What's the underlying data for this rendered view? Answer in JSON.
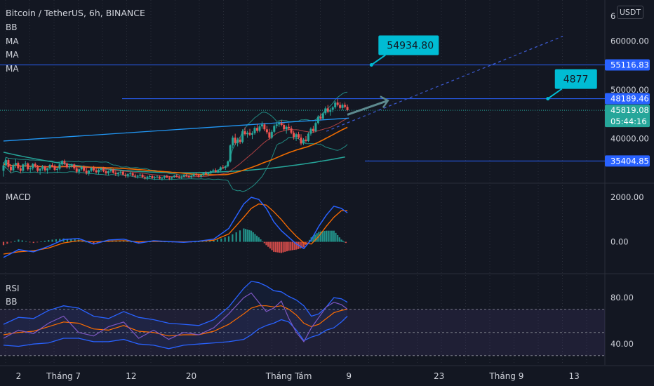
{
  "header": {
    "title": "Bitcoin / TetherUS, 6h, BINANCE",
    "unit": "USDT",
    "indicators": [
      "BB",
      "MA",
      "MA",
      "MA"
    ]
  },
  "colors": {
    "up": "#26a69a",
    "down": "#ef5350",
    "hline": "#2962ff",
    "callout": "#00bcd4",
    "projection": "#3a57c9",
    "arrow": "#5d8a8f",
    "ma_short": "#ef6c00",
    "ma_long": "#26a69a",
    "bb": "#2962ff",
    "trend": "#2196f3",
    "macd": "#2962ff",
    "signal": "#ff6d00",
    "rsi": "#7e57c2",
    "rsi_ma": "#ff6d00"
  },
  "chart_data": [
    {
      "type": "candlestick",
      "ylim": [
        31000,
        68000
      ],
      "y_ticks": [
        40000,
        50000,
        60000
      ],
      "y_tick_labels": [
        "40000.00",
        "50000.00",
        "60000.00"
      ],
      "partial_top_label": "6",
      "x_labels": [
        "2",
        "Tháng 7",
        "12",
        "20",
        "Tháng Tám",
        "9",
        "23",
        "Tháng 9",
        "13"
      ],
      "x_label_days": [
        2,
        8,
        17,
        25,
        38,
        46,
        58,
        67,
        76
      ],
      "candle_days": [
        0,
        45.8
      ],
      "levels": [
        {
          "name": "resistance",
          "price": 55116.83,
          "label": "55116.83"
        },
        {
          "name": "target",
          "price": 48189.46,
          "label": "48189.46"
        },
        {
          "name": "support",
          "price": 35404.85,
          "label": "35404.85"
        }
      ],
      "last_price": {
        "price": 45819.08,
        "label": "45819.08",
        "countdown": "05:44:16"
      },
      "callouts": [
        {
          "text": "54934.80",
          "day": 49,
          "price": 55116.83
        },
        {
          "text": "4877",
          "day": 72.5,
          "price": 48189.46
        }
      ],
      "projection_line": {
        "from": [
          43,
          41500
        ],
        "to": [
          74.5,
          61000
        ]
      },
      "arrow": {
        "from": [
          45.8,
          44900
        ],
        "to": [
          51.2,
          47800
        ]
      },
      "trend_line": {
        "from": [
          0,
          39500
        ],
        "to": [
          46,
          44200
        ]
      },
      "ohlc": [
        [
          33.4,
          35.2,
          32.2,
          34.5
        ],
        [
          34.5,
          36.2,
          34.0,
          35.6
        ],
        [
          35.6,
          35.9,
          33.8,
          34.2
        ],
        [
          34.2,
          34.8,
          33.0,
          33.5
        ],
        [
          33.5,
          34.9,
          33.2,
          34.6
        ],
        [
          34.6,
          35.8,
          34.0,
          35.0
        ],
        [
          35.0,
          35.3,
          33.6,
          33.9
        ],
        [
          33.9,
          34.5,
          32.9,
          33.4
        ],
        [
          33.4,
          34.9,
          33.1,
          34.7
        ],
        [
          34.7,
          35.4,
          34.2,
          34.9
        ],
        [
          34.9,
          35.1,
          33.4,
          33.7
        ],
        [
          33.7,
          34.3,
          33.0,
          33.9
        ],
        [
          33.9,
          35.0,
          33.5,
          34.8
        ],
        [
          34.8,
          35.1,
          34.0,
          34.3
        ],
        [
          34.3,
          34.6,
          33.1,
          33.4
        ],
        [
          33.4,
          34.0,
          32.6,
          33.8
        ],
        [
          33.8,
          34.6,
          33.4,
          34.3
        ],
        [
          34.3,
          34.5,
          33.2,
          33.5
        ],
        [
          33.5,
          34.0,
          32.8,
          33.9
        ],
        [
          33.9,
          34.8,
          33.6,
          34.6
        ],
        [
          34.6,
          35.0,
          34.1,
          34.4
        ],
        [
          34.4,
          34.7,
          33.3,
          33.6
        ],
        [
          33.6,
          34.1,
          33.0,
          33.8
        ],
        [
          33.8,
          34.9,
          33.5,
          34.7
        ],
        [
          34.7,
          35.6,
          34.4,
          35.4
        ],
        [
          35.4,
          35.7,
          34.6,
          34.9
        ],
        [
          34.9,
          35.1,
          33.8,
          34.1
        ],
        [
          34.1,
          34.6,
          33.7,
          34.4
        ],
        [
          34.4,
          34.9,
          34.0,
          34.7
        ],
        [
          34.7,
          34.9,
          33.6,
          33.9
        ],
        [
          33.9,
          34.2,
          32.9,
          33.2
        ],
        [
          33.2,
          33.9,
          32.7,
          33.7
        ],
        [
          33.7,
          34.4,
          33.4,
          34.2
        ],
        [
          34.2,
          34.5,
          33.1,
          33.4
        ],
        [
          33.4,
          34.0,
          32.6,
          32.9
        ],
        [
          32.9,
          33.6,
          32.4,
          33.4
        ],
        [
          33.4,
          34.2,
          33.1,
          34.0
        ],
        [
          34.0,
          34.4,
          33.2,
          33.5
        ],
        [
          33.5,
          33.9,
          32.8,
          33.1
        ],
        [
          33.1,
          33.8,
          32.6,
          33.6
        ],
        [
          33.6,
          34.1,
          33.2,
          33.9
        ],
        [
          33.9,
          34.2,
          33.1,
          33.3
        ],
        [
          33.3,
          33.7,
          32.5,
          32.9
        ],
        [
          32.9,
          33.5,
          32.4,
          33.3
        ],
        [
          33.3,
          33.9,
          33.0,
          33.6
        ],
        [
          33.6,
          33.8,
          32.8,
          33.0
        ],
        [
          33.0,
          33.4,
          32.3,
          32.7
        ],
        [
          32.7,
          33.2,
          32.2,
          33.0
        ],
        [
          33.0,
          33.5,
          32.7,
          33.2
        ],
        [
          33.2,
          33.4,
          32.4,
          32.6
        ],
        [
          32.6,
          33.0,
          32.0,
          32.4
        ],
        [
          32.4,
          32.9,
          31.9,
          32.7
        ],
        [
          32.7,
          33.2,
          32.4,
          32.9
        ],
        [
          32.9,
          33.1,
          32.2,
          32.4
        ],
        [
          32.4,
          32.8,
          31.9,
          32.2
        ],
        [
          32.2,
          32.6,
          31.8,
          32.4
        ],
        [
          32.4,
          32.9,
          32.1,
          32.6
        ],
        [
          32.6,
          32.8,
          31.9,
          32.1
        ],
        [
          32.1,
          32.5,
          31.6,
          31.9
        ],
        [
          31.9,
          32.4,
          31.5,
          32.2
        ],
        [
          32.2,
          32.6,
          31.9,
          32.3
        ],
        [
          32.3,
          32.5,
          31.7,
          31.9
        ],
        [
          31.9,
          32.3,
          31.5,
          32.1
        ],
        [
          32.1,
          32.5,
          31.8,
          32.2
        ],
        [
          32.2,
          32.4,
          31.6,
          31.8
        ],
        [
          31.8,
          32.2,
          31.4,
          32.0
        ],
        [
          32.0,
          32.5,
          31.7,
          32.3
        ],
        [
          32.3,
          32.6,
          31.9,
          32.0
        ],
        [
          32.0,
          32.3,
          31.5,
          31.8
        ],
        [
          31.8,
          32.2,
          31.5,
          32.1
        ],
        [
          32.1,
          32.6,
          31.9,
          32.4
        ],
        [
          32.4,
          32.7,
          32.0,
          32.2
        ],
        [
          32.2,
          32.5,
          31.8,
          32.0
        ],
        [
          32.0,
          32.4,
          31.7,
          32.2
        ],
        [
          32.2,
          32.7,
          32.0,
          32.5
        ],
        [
          32.5,
          32.8,
          32.1,
          32.3
        ],
        [
          32.3,
          32.6,
          31.9,
          32.1
        ],
        [
          32.1,
          32.5,
          31.8,
          32.3
        ],
        [
          32.3,
          32.9,
          32.1,
          32.7
        ],
        [
          32.7,
          33.0,
          32.3,
          32.5
        ],
        [
          32.5,
          32.8,
          32.0,
          32.2
        ],
        [
          32.2,
          32.7,
          31.9,
          32.5
        ],
        [
          32.5,
          33.1,
          32.3,
          32.9
        ],
        [
          32.9,
          33.3,
          32.5,
          32.7
        ],
        [
          32.7,
          33.1,
          32.3,
          32.9
        ],
        [
          32.9,
          33.5,
          32.7,
          33.3
        ],
        [
          33.3,
          33.8,
          33.0,
          33.5
        ],
        [
          33.5,
          33.9,
          33.0,
          33.2
        ],
        [
          33.2,
          33.7,
          32.9,
          33.5
        ],
        [
          33.5,
          34.3,
          33.3,
          34.1
        ],
        [
          34.1,
          34.6,
          33.7,
          34.0
        ],
        [
          34.0,
          34.5,
          33.6,
          34.3
        ],
        [
          34.3,
          35.5,
          34.1,
          35.3
        ],
        [
          35.3,
          38.8,
          35.1,
          38.6
        ],
        [
          38.6,
          40.6,
          38.0,
          40.2
        ],
        [
          40.2,
          41.0,
          38.7,
          39.1
        ],
        [
          39.1,
          40.2,
          38.4,
          39.8
        ],
        [
          39.8,
          40.4,
          38.9,
          39.3
        ],
        [
          39.3,
          41.9,
          39.0,
          41.5
        ],
        [
          41.5,
          42.3,
          40.6,
          40.9
        ],
        [
          40.9,
          41.6,
          40.2,
          41.2
        ],
        [
          41.2,
          42.0,
          40.5,
          40.8
        ],
        [
          40.8,
          41.5,
          39.9,
          41.1
        ],
        [
          41.1,
          42.5,
          40.8,
          42.2
        ],
        [
          42.2,
          43.0,
          41.2,
          41.6
        ],
        [
          41.6,
          42.8,
          41.3,
          42.5
        ],
        [
          42.5,
          43.5,
          42.0,
          42.9
        ],
        [
          42.9,
          43.2,
          41.5,
          41.9
        ],
        [
          41.9,
          42.6,
          40.9,
          41.3
        ],
        [
          41.3,
          42.0,
          39.8,
          40.2
        ],
        [
          40.2,
          41.8,
          39.9,
          41.4
        ],
        [
          41.4,
          42.9,
          41.1,
          42.6
        ],
        [
          42.6,
          43.4,
          42.1,
          42.9
        ],
        [
          42.9,
          43.6,
          42.4,
          43.2
        ],
        [
          43.2,
          43.8,
          42.5,
          42.8
        ],
        [
          42.8,
          43.3,
          41.6,
          41.9
        ],
        [
          41.9,
          42.7,
          41.0,
          42.4
        ],
        [
          42.4,
          43.1,
          41.7,
          42.1
        ],
        [
          42.1,
          42.6,
          40.9,
          41.2
        ],
        [
          41.2,
          41.6,
          39.8,
          40.3
        ],
        [
          40.3,
          41.2,
          39.5,
          40.9
        ],
        [
          40.9,
          41.4,
          39.9,
          40.2
        ],
        [
          40.2,
          40.9,
          38.6,
          39.0
        ],
        [
          39.0,
          40.1,
          38.7,
          39.8
        ],
        [
          39.8,
          40.5,
          39.2,
          39.5
        ],
        [
          39.5,
          41.3,
          39.3,
          41.0
        ],
        [
          41.0,
          42.3,
          40.6,
          42.0
        ],
        [
          42.0,
          42.6,
          41.2,
          41.5
        ],
        [
          41.5,
          43.5,
          41.3,
          43.2
        ],
        [
          43.2,
          44.8,
          42.9,
          44.5
        ],
        [
          44.5,
          45.2,
          43.8,
          44.1
        ],
        [
          44.1,
          45.5,
          43.9,
          45.2
        ],
        [
          45.2,
          46.6,
          44.8,
          46.2
        ],
        [
          46.2,
          46.9,
          45.2,
          45.5
        ],
        [
          45.5,
          46.3,
          44.7,
          45.9
        ],
        [
          45.9,
          46.7,
          45.4,
          46.4
        ],
        [
          46.4,
          47.7,
          46.1,
          47.4
        ],
        [
          47.4,
          48.2,
          46.6,
          46.9
        ],
        [
          46.9,
          47.5,
          46.0,
          46.3
        ],
        [
          46.3,
          47.2,
          45.8,
          46.9
        ],
        [
          46.9,
          47.4,
          46.2,
          46.5
        ],
        [
          46.5,
          47.0,
          45.6,
          45.82
        ]
      ]
    },
    {
      "type": "line",
      "name": "MACD",
      "ylim": [
        -1400,
        2600
      ],
      "y_ticks": [
        0,
        2000
      ],
      "y_tick_labels": [
        "0.00",
        "2000.00"
      ],
      "x": [
        0,
        2,
        4,
        6,
        8,
        10,
        12,
        14,
        16,
        18,
        20,
        22,
        24,
        26,
        28,
        30,
        32,
        33,
        34,
        35,
        36,
        37,
        38,
        39,
        40,
        41,
        42,
        43,
        44,
        45,
        45.8
      ],
      "series": [
        {
          "name": "macd",
          "values": [
            -700,
            -350,
            -450,
            -200,
            100,
            150,
            -100,
            80,
            120,
            -60,
            50,
            10,
            -20,
            30,
            120,
            600,
            1700,
            2000,
            1900,
            1500,
            900,
            500,
            200,
            -100,
            -300,
            100,
            700,
            1200,
            1600,
            1500,
            1300
          ]
        },
        {
          "name": "signal",
          "values": [
            -550,
            -450,
            -400,
            -280,
            -50,
            50,
            0,
            30,
            50,
            0,
            20,
            10,
            0,
            20,
            70,
            350,
            1100,
            1500,
            1700,
            1650,
            1350,
            1000,
            600,
            250,
            -50,
            -100,
            250,
            700,
            1100,
            1400,
            1400
          ]
        },
        {
          "name": "histogram",
          "values": [
            -150,
            100,
            -50,
            80,
            150,
            100,
            -100,
            50,
            70,
            -60,
            30,
            0,
            -20,
            10,
            50,
            250,
            600,
            500,
            200,
            -150,
            -450,
            -500,
            -400,
            -350,
            -250,
            200,
            450,
            500,
            500,
            100,
            -100
          ]
        }
      ]
    },
    {
      "type": "line",
      "name": "RSI",
      "ylim": [
        22,
        100
      ],
      "y_ticks": [
        40,
        80
      ],
      "y_tick_labels": [
        "40.00",
        "80.00"
      ],
      "levels": [
        30,
        50,
        70
      ],
      "x": [
        0,
        2,
        4,
        6,
        8,
        10,
        12,
        14,
        16,
        18,
        20,
        22,
        24,
        26,
        28,
        30,
        32,
        33,
        34,
        35,
        36,
        37,
        38,
        39,
        40,
        41,
        42,
        43,
        44,
        45,
        45.8
      ],
      "series": [
        {
          "name": "rsi",
          "values": [
            45,
            52,
            49,
            58,
            64,
            50,
            47,
            55,
            59,
            45,
            52,
            44,
            50,
            48,
            54,
            66,
            80,
            84,
            76,
            68,
            71,
            77,
            62,
            50,
            42,
            54,
            63,
            72,
            76,
            74,
            70
          ]
        },
        {
          "name": "rsi_ma",
          "values": [
            48,
            50,
            51,
            55,
            59,
            58,
            53,
            52,
            56,
            51,
            50,
            47,
            48,
            48,
            51,
            57,
            66,
            71,
            73,
            73,
            72,
            73,
            70,
            65,
            58,
            55,
            57,
            62,
            67,
            69,
            70
          ]
        },
        {
          "name": "bb_upper",
          "values": [
            57,
            63,
            62,
            69,
            73,
            71,
            64,
            62,
            68,
            63,
            61,
            58,
            57,
            56,
            61,
            72,
            88,
            94,
            93,
            90,
            86,
            85,
            81,
            78,
            73,
            64,
            66,
            72,
            80,
            79,
            76
          ]
        },
        {
          "name": "bb_lower",
          "values": [
            39,
            38,
            40,
            41,
            45,
            45,
            42,
            42,
            44,
            40,
            39,
            36,
            39,
            40,
            41,
            42,
            44,
            48,
            53,
            56,
            58,
            61,
            59,
            52,
            43,
            46,
            48,
            52,
            54,
            59,
            64
          ]
        }
      ]
    }
  ]
}
